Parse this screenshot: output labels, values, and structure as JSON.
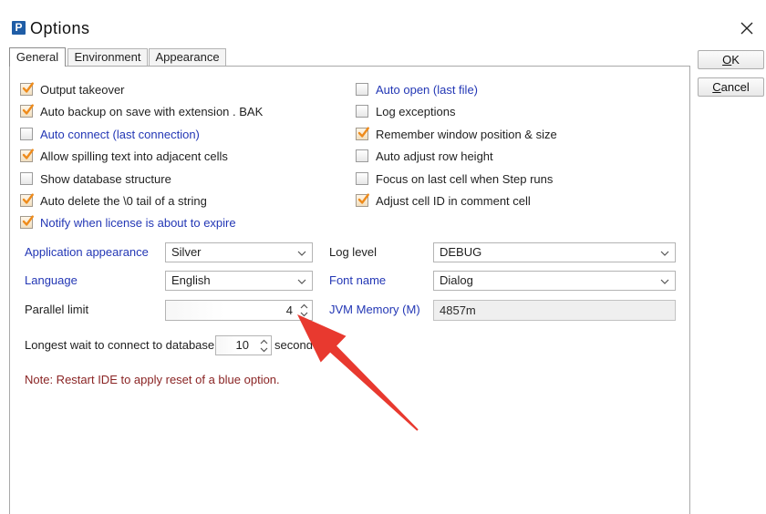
{
  "window": {
    "title": "Options",
    "icon_letter": "P",
    "close_icon": "close-icon"
  },
  "colors": {
    "restart_option_text": "#2337b5",
    "note_text": "#8a2424",
    "checkmark": "#ee8b1b",
    "annotation_arrow": "#e8392f",
    "app_icon": "#1f5da6"
  },
  "tabs": [
    {
      "label": "General",
      "selected": true
    },
    {
      "label": "Environment",
      "selected": false
    },
    {
      "label": "Appearance",
      "selected": false
    }
  ],
  "buttons": {
    "ok": {
      "mnemonic": "O",
      "rest": "K"
    },
    "cancel": {
      "mnemonic": "C",
      "rest": "ancel"
    }
  },
  "options": {
    "left": [
      {
        "label": "Output takeover",
        "checked": true,
        "restart_required": false
      },
      {
        "label": "Auto backup on save with extension . BAK",
        "checked": true,
        "restart_required": false
      },
      {
        "label": "Auto connect (last connection)",
        "checked": false,
        "restart_required": true
      },
      {
        "label": "Allow spilling text into adjacent cells",
        "checked": true,
        "restart_required": false
      },
      {
        "label": "Show database structure",
        "checked": false,
        "restart_required": false
      },
      {
        "label": "Auto delete the \\0 tail of a string",
        "checked": true,
        "restart_required": false
      },
      {
        "label": "Notify when license is about to expire",
        "checked": true,
        "restart_required": true
      }
    ],
    "right": [
      {
        "label": "Auto open (last file)",
        "checked": false,
        "restart_required": true
      },
      {
        "label": "Log exceptions",
        "checked": false,
        "restart_required": false
      },
      {
        "label": "Remember window position & size",
        "checked": true,
        "restart_required": false
      },
      {
        "label": "Auto adjust row height",
        "checked": false,
        "restart_required": false
      },
      {
        "label": "Focus on last cell when Step runs",
        "checked": false,
        "restart_required": false
      },
      {
        "label": "Adjust cell ID in comment cell",
        "checked": true,
        "restart_required": false
      }
    ]
  },
  "fields": {
    "application_appearance": {
      "label": "Application appearance",
      "value": "Silver",
      "restart_required": true
    },
    "log_level": {
      "label": "Log level",
      "value": "DEBUG",
      "restart_required": false
    },
    "language": {
      "label": "Language",
      "value": "English",
      "restart_required": true
    },
    "font_name": {
      "label": "Font name",
      "value": "Dialog",
      "restart_required": true
    },
    "parallel_limit": {
      "label": "Parallel limit",
      "value": "4",
      "restart_required": false
    },
    "jvm_memory": {
      "label": "JVM Memory (M)",
      "value": "4857m",
      "restart_required": true,
      "read_only": true
    },
    "db_connect_wait": {
      "label": "Longest wait to connect to database",
      "value": "10",
      "unit": "second",
      "restart_required": false
    }
  },
  "note": "Note: Restart IDE to apply reset of a blue option.",
  "icons": {
    "dropdown": "chevron-down-icon",
    "spinner": "spinner-arrows-icon",
    "checkmark": "checkmark-icon",
    "annotation": "red-arrow-annotation"
  }
}
